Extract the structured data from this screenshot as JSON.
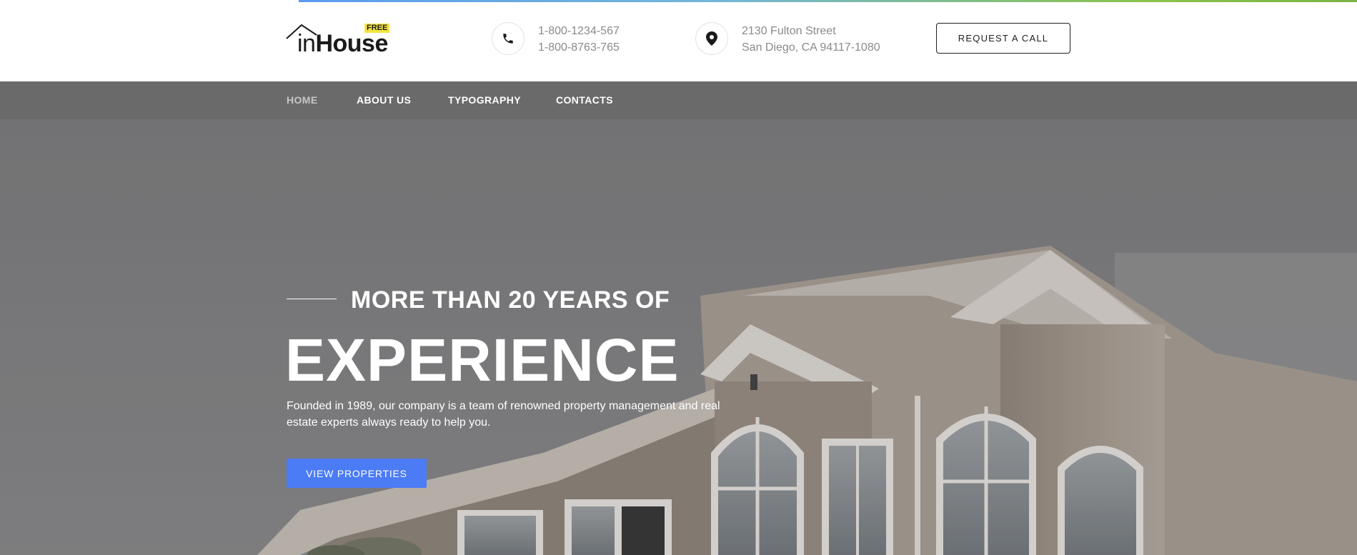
{
  "brand": {
    "logo_prefix": "in",
    "logo_name": "House",
    "badge": "FREE"
  },
  "contacts": {
    "phone_icon": "phone-icon",
    "phone_1": "1-800-1234-567",
    "phone_2": "1-800-8763-765",
    "address_icon": "map-pin-icon",
    "address_line_1": "2130 Fulton Street",
    "address_line_2": "San Diego, CA 94117-1080"
  },
  "header": {
    "request_button": "REQUEST A CALL"
  },
  "nav": {
    "items": [
      {
        "label": "HOME",
        "active": true
      },
      {
        "label": "ABOUT US",
        "active": false
      },
      {
        "label": "TYPOGRAPHY",
        "active": false
      },
      {
        "label": "CONTACTS",
        "active": false
      }
    ]
  },
  "hero": {
    "kicker": "MORE THAN 20 YEARS OF",
    "headline": "EXPERIENCE",
    "description": "Founded in 1989, our company is a team of renowned property management and real estate experts always ready to help you.",
    "cta": "VIEW PROPERTIES"
  },
  "colors": {
    "accent": "#4b7bf5",
    "badge": "#f4e542",
    "nav_bar": "#6e6e6e",
    "hero_sky": "#7b7b7c"
  }
}
